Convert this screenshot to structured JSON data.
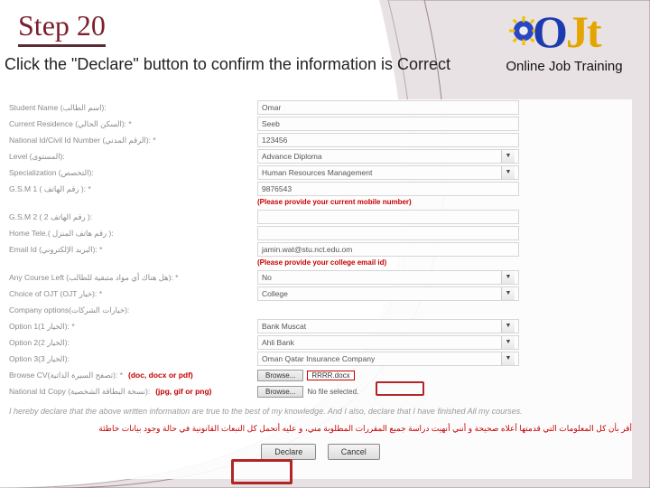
{
  "title": "Step 20",
  "subtitle": "Click the \"Declare\" button to confirm the information is Correct",
  "logo_text": "Online Job Training",
  "logo_letters": {
    "o": "O",
    "j": "J",
    "t": "t"
  },
  "fields": {
    "student_name": {
      "label": "Student Name (اسم الطالب):",
      "value": "Omar",
      "req": false
    },
    "residence": {
      "label": "Current Residence (السكن الحالي):  *",
      "value": "Seeb",
      "req": true
    },
    "national_id": {
      "label": "National Id/Civil Id Number (الرقم المدني):  *",
      "value": "123456",
      "req": true
    },
    "level": {
      "label": "Level (المستوى):",
      "value": "Advance Diploma",
      "req": false,
      "dd": true
    },
    "spec": {
      "label": "Specialization (التخصص):",
      "value": "Human Resources Management",
      "req": false,
      "dd": true
    },
    "gsm1": {
      "label": "G.S.M 1 ( رقم الهاتف ):  *",
      "value": "9876543",
      "req": true
    },
    "gsm1_hint": "(Please provide your current mobile number)",
    "gsm2": {
      "label": "G.S.M 2 ( 2 رقم الهاتف ):",
      "value": "",
      "req": false
    },
    "home": {
      "label": "Home Tele.( رقم هاتف المنزل ):",
      "value": "",
      "req": false
    },
    "email": {
      "label": "Email Id (البريد الإلكتروني):  *",
      "value": "jamin.wat@stu.nct.edu.om",
      "req": true
    },
    "email_hint": "(Please provide your college email id)",
    "anyleft": {
      "label": "Any Course Left (هل هناك أي مواد متبقية للطالب):  *",
      "value": "No",
      "req": true,
      "dd": true
    },
    "choice": {
      "label": "Choice of OJT (OJT خيار):  *",
      "value": "College",
      "req": true,
      "dd": true
    },
    "company_hdr": "Company options(خيارات الشركات):",
    "opt1": {
      "label": "Option 1(1 الخيار):  *",
      "value": "Bank Muscat",
      "req": true,
      "dd": true
    },
    "opt2": {
      "label": "Option 2(2 الخيار):",
      "value": "Ahli Bank",
      "req": false,
      "dd": true
    },
    "opt3": {
      "label": "Option 3(3 الخيار):",
      "value": "Oman Qatar Insurance Company",
      "req": false,
      "dd": true
    },
    "cv": {
      "label": "Browse CV(تصفح السيرة الذاتية):  *",
      "ext": "(doc, docx or pdf)",
      "btn": "Browse...",
      "file": "RRRR.docx",
      "req": true
    },
    "idcopy": {
      "label": "National Id Copy (نسخة البطاقة الشخصية):",
      "ext": "(jpg, gif or png)",
      "btn": "Browse...",
      "file": "No file selected.",
      "req": false
    }
  },
  "declaration_en": "I hereby declare that the above written information are true to the best of my knowledge. And I also, declare that I have finished All my courses.",
  "declaration_ar": "أقر بأن كل المعلومات التي قدمتها أعلاه صحيحة و أنني أنهيت دراسة جميع المقررات المطلوبة مني، و عليه أتحمل كل التبعات القانونية في حالة وجود بيانات خاطئة",
  "buttons": {
    "declare": "Declare",
    "cancel": "Cancel"
  }
}
